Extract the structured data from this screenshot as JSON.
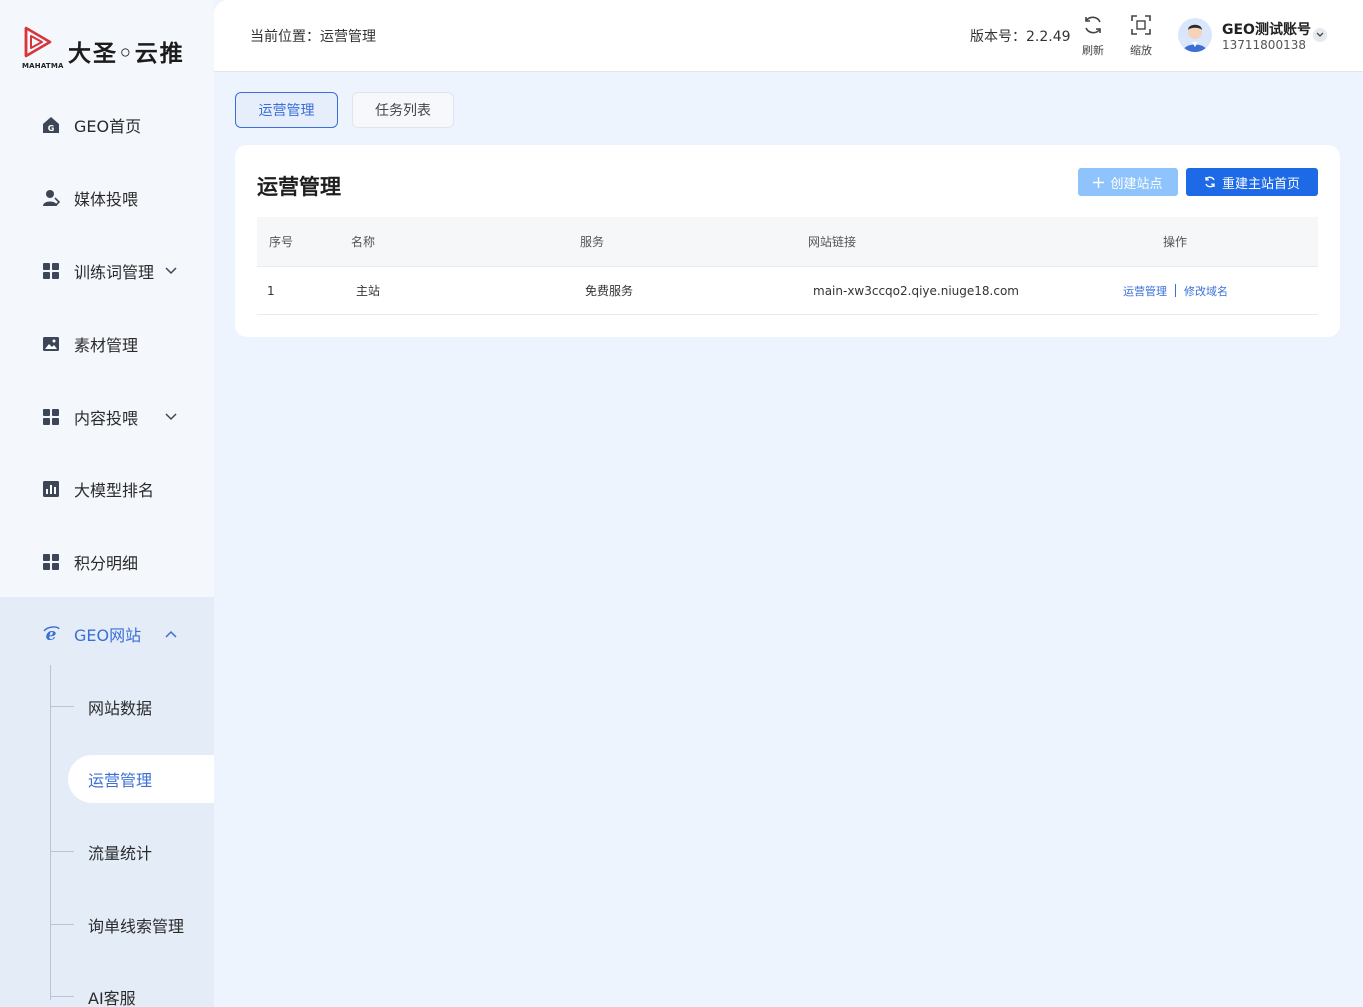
{
  "logo": {
    "name": "大圣◦云推",
    "sub": "MAHATMA"
  },
  "nav": [
    {
      "label": "GEO首页",
      "icon": "home-icon"
    },
    {
      "label": "媒体投喂",
      "icon": "user-icon"
    },
    {
      "label": "训练词管理",
      "icon": "grid-icon",
      "expandable": true
    },
    {
      "label": "素材管理",
      "icon": "image-icon"
    },
    {
      "label": "内容投喂",
      "icon": "grid-icon",
      "expandable": true
    },
    {
      "label": "大模型排名",
      "icon": "bar-chart-icon"
    },
    {
      "label": "积分明细",
      "icon": "grid-icon"
    },
    {
      "label": "GEO网站",
      "icon": "ie-icon",
      "expanded": true
    }
  ],
  "subnav": [
    {
      "label": "网站数据"
    },
    {
      "label": "运营管理",
      "active": true
    },
    {
      "label": "流量统计"
    },
    {
      "label": "询单线索管理"
    },
    {
      "label": "AI客服"
    }
  ],
  "header": {
    "breadcrumb": "当前位置：运营管理",
    "version": "版本号：2.2.49",
    "refresh_label": "刷新",
    "zoom_label": "缩放",
    "user_name": "GEO测试账号",
    "user_phone": "13711800138"
  },
  "tabs": [
    {
      "label": "运营管理",
      "active": true
    },
    {
      "label": "任务列表",
      "active": false
    }
  ],
  "card": {
    "title": "运营管理",
    "create_button": "创建站点",
    "rebuild_button": "重建主站首页"
  },
  "table": {
    "columns": [
      "序号",
      "名称",
      "服务",
      "网站链接",
      "操作"
    ],
    "rows": [
      {
        "index": "1",
        "name": "主站",
        "service": "免费服务",
        "url": "main-xw3ccqo2.qiye.niuge18.com",
        "actions": [
          "运营管理",
          "修改域名"
        ]
      }
    ]
  },
  "colors": {
    "accent": "#3b6fd6",
    "primary_button": "#1e6ae6",
    "disabled_button": "#8ec3fb",
    "page_bg": "#eef4fd"
  }
}
